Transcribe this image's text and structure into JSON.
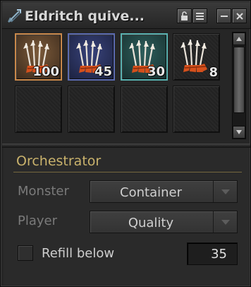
{
  "window": {
    "title": "Eldritch quive..."
  },
  "inventory": {
    "slots": [
      {
        "count": "100",
        "rarity": "orange"
      },
      {
        "count": "45",
        "rarity": "blue"
      },
      {
        "count": "30",
        "rarity": "teal"
      },
      {
        "count": "8",
        "rarity": "none"
      },
      {
        "count": "",
        "rarity": "empty"
      },
      {
        "count": "",
        "rarity": "empty"
      },
      {
        "count": "",
        "rarity": "empty"
      },
      {
        "count": "",
        "rarity": "empty"
      }
    ],
    "item_icon": "arrow-bundle-icon"
  },
  "orchestrator": {
    "title": "Orchestrator",
    "monster_label": "Monster",
    "monster_value": "Container",
    "player_label": "Player",
    "player_value": "Quality",
    "refill_label": "Refill below",
    "refill_value": "35",
    "refill_checked": false
  },
  "colors": {
    "accent_gold": "#c9b26c",
    "rarity_orange": "#c9884a",
    "rarity_blue": "#5a6ab0",
    "rarity_teal": "#58b2b0"
  }
}
